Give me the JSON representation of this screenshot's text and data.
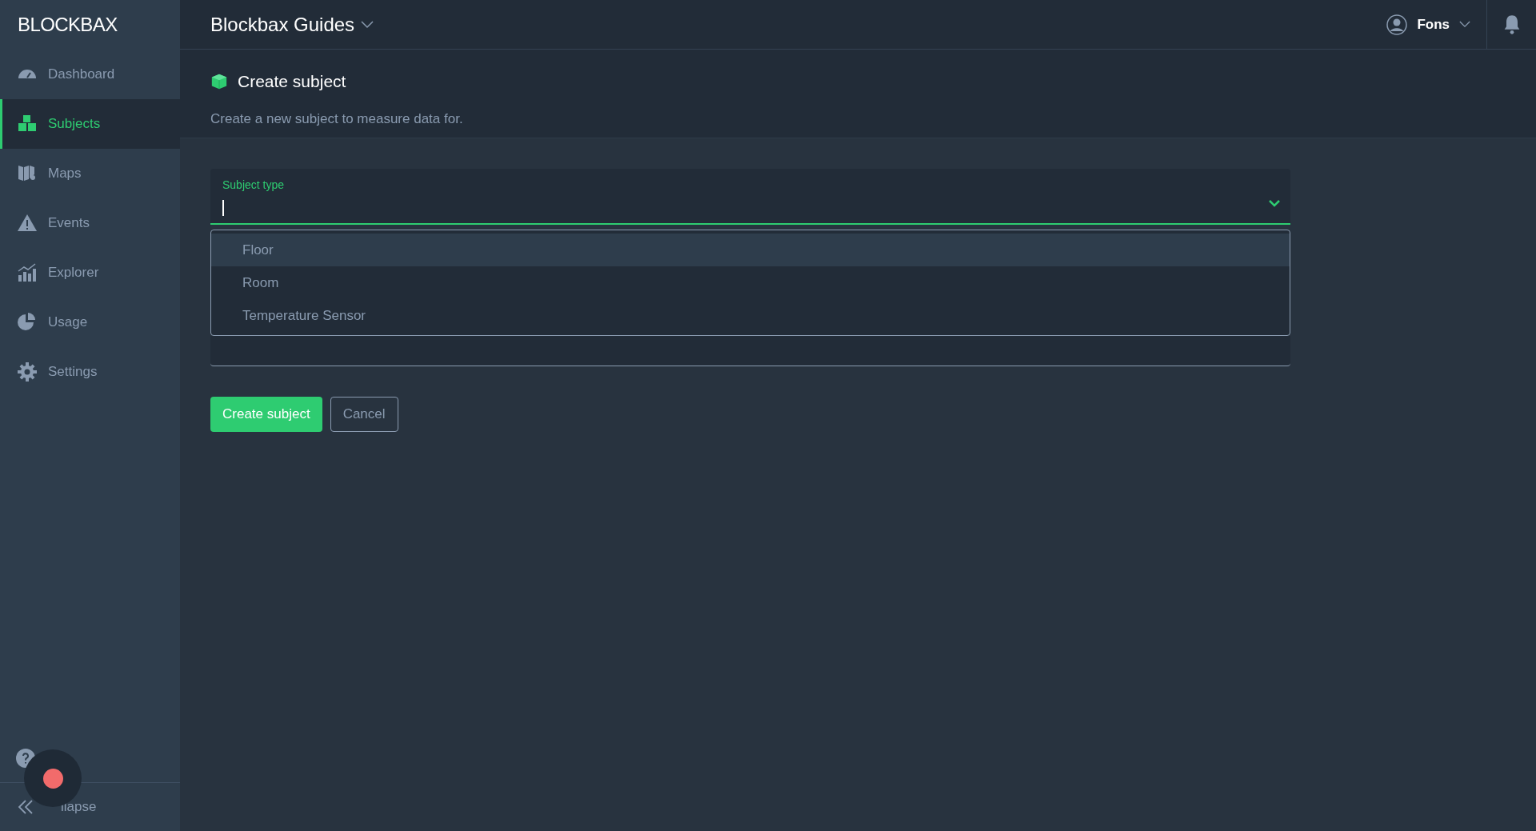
{
  "sidebar": {
    "logo": "BLOCKBAX",
    "items": [
      {
        "label": "Dashboard",
        "selected": false
      },
      {
        "label": "Subjects",
        "selected": true
      },
      {
        "label": "Maps",
        "selected": false
      },
      {
        "label": "Events",
        "selected": false
      },
      {
        "label": "Explorer",
        "selected": false
      },
      {
        "label": "Usage",
        "selected": false
      },
      {
        "label": "Settings",
        "selected": false
      }
    ],
    "collapse": "llapse"
  },
  "header": {
    "project": "Blockbax Guides",
    "user": "Fons"
  },
  "page": {
    "title": "Create subject",
    "description": "Create a new subject to measure data for."
  },
  "form": {
    "field_label": "Subject type",
    "options": [
      {
        "label": "Floor",
        "selected": true
      },
      {
        "label": "Room",
        "selected": false
      },
      {
        "label": "Temperature Sensor",
        "selected": false
      }
    ],
    "buttons": [
      {
        "label": "Create subject",
        "kind": "primary"
      },
      {
        "label": "Cancel",
        "kind": "secondary"
      }
    ]
  }
}
